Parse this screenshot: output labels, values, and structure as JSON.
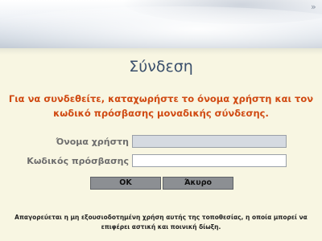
{
  "header": {
    "corner_glyph": "»"
  },
  "login": {
    "title": "Σύνδεση",
    "instructions": "Για να συνδεθείτε, καταχωρήστε το όνομα χρήστη και τον κωδικό πρόσβασης μοναδικής σύνδεσης.",
    "username_label": "Όνομα χρήστη",
    "username_value": "",
    "password_label": "Κωδικός πρόσβασης",
    "password_value": "",
    "ok_label": "OK",
    "cancel_label": "Άκυρο"
  },
  "footer": {
    "warning": "Απαγορεύεται η μη εξουσιοδοτημένη χρήση αυτής της τοποθεσίας, η οποία μπορεί να επιφέρει αστική και ποινική δίωξη."
  },
  "colors": {
    "background": "#f8f6e2",
    "title": "#3a4f6b",
    "instructions": "#d04a12",
    "label": "#6e6e6e",
    "button": "#8c8f93"
  }
}
